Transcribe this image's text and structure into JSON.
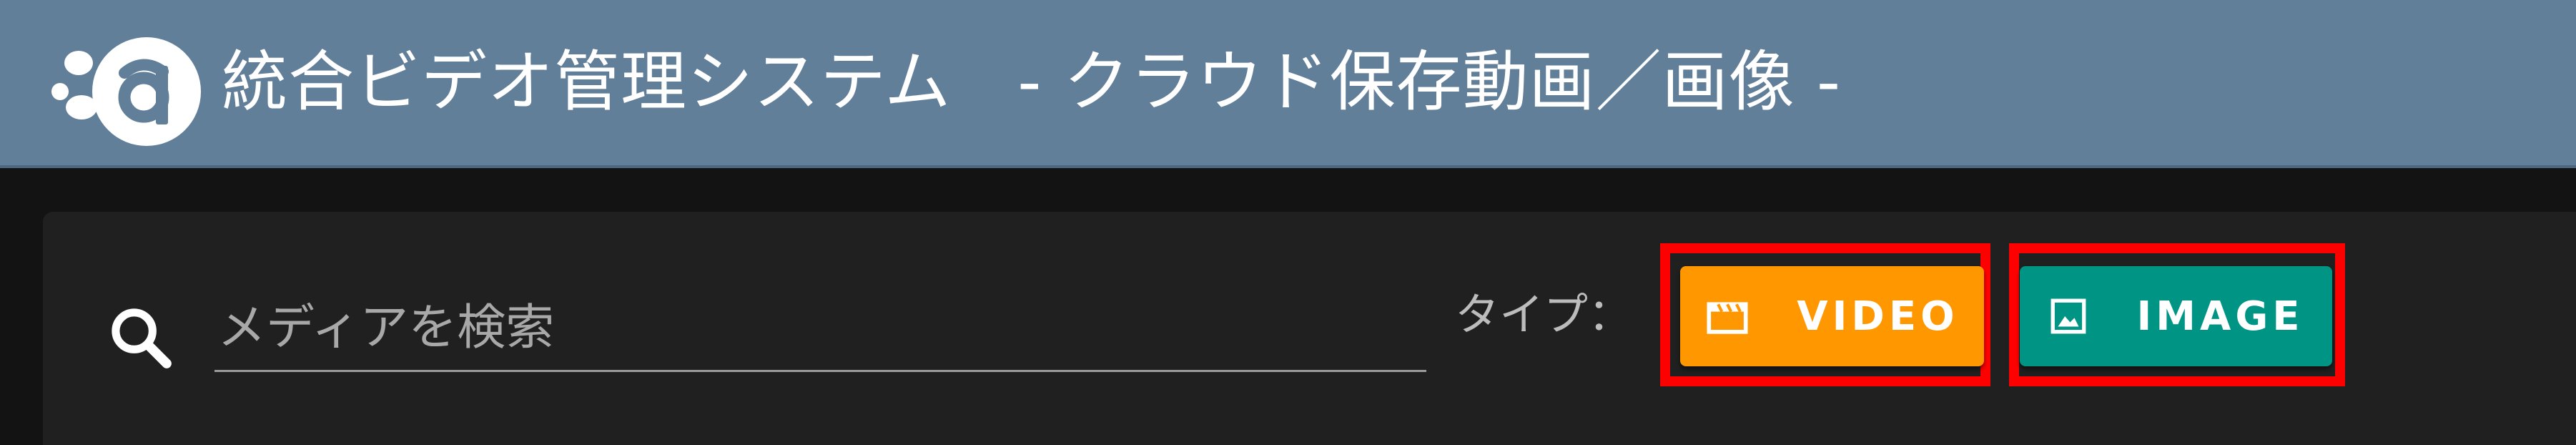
{
  "header": {
    "title": "統合ビデオ管理システム　- クラウド保存動画／画像 -",
    "logo_icon": "app-logo-a-icon",
    "background": "#627f9a"
  },
  "search": {
    "placeholder": "メディアを検索",
    "value": "",
    "icon": "search-icon"
  },
  "filter": {
    "type_label": "タイプ：",
    "buttons": [
      {
        "label": "VIDEO",
        "icon": "clapperboard-icon",
        "color": "#ff9800"
      },
      {
        "label": "IMAGE",
        "icon": "image-icon",
        "color": "#009485"
      }
    ],
    "highlight_color": "#ff0000"
  }
}
